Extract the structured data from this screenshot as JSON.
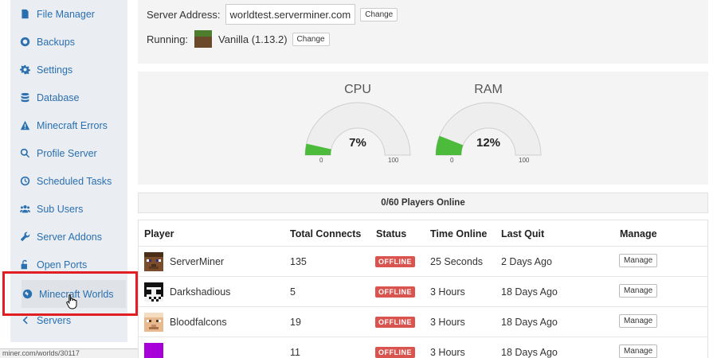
{
  "sidebar": {
    "items": [
      {
        "label": "File Manager",
        "icon": "file-icon"
      },
      {
        "label": "Backups",
        "icon": "lifebuoy-icon"
      },
      {
        "label": "Settings",
        "icon": "gear-icon"
      },
      {
        "label": "Database",
        "icon": "database-icon"
      },
      {
        "label": "Minecraft Errors",
        "icon": "warning-icon"
      },
      {
        "label": "Profile Server",
        "icon": "search-icon"
      },
      {
        "label": "Scheduled Tasks",
        "icon": "clock-icon"
      },
      {
        "label": "Sub Users",
        "icon": "users-icon"
      },
      {
        "label": "Server Addons",
        "icon": "wrench-icon"
      },
      {
        "label": "Open Ports",
        "icon": "unlock-icon"
      },
      {
        "label": "Minecraft Worlds",
        "icon": "globe-icon"
      }
    ],
    "back": {
      "label": "Servers",
      "icon": "chevron-left-icon"
    },
    "link_color": "#2a6fb0"
  },
  "statusbar": {
    "url": "miner.com/worlds/30117"
  },
  "server": {
    "address_label": "Server Address:",
    "address": "worldtest.serverminer.com",
    "change_label": "Change",
    "running_label": "Running:",
    "version": "Vanilla (1.13.2)"
  },
  "gauges": [
    {
      "title": "CPU",
      "value": 7,
      "display": "7%",
      "min_label": "0",
      "max_label": "100"
    },
    {
      "title": "RAM",
      "value": 12,
      "display": "12%",
      "min_label": "0",
      "max_label": "100"
    }
  ],
  "gauge_colors": {
    "fill": "#4cbb3c",
    "track": "#eeeeee"
  },
  "players": {
    "header": "0/60 Players Online",
    "columns": [
      "Player",
      "Total Connects",
      "Status",
      "Time Online",
      "Last Quit",
      "Manage"
    ],
    "rows": [
      {
        "name": "ServerMiner",
        "connects": "135",
        "status": "OFFLINE",
        "time_online": "25 Seconds",
        "last_quit": "2 Days Ago",
        "manage": "Manage"
      },
      {
        "name": "Darkshadious",
        "connects": "5",
        "status": "OFFLINE",
        "time_online": "3 Hours",
        "last_quit": "18 Days Ago",
        "manage": "Manage"
      },
      {
        "name": "Bloodfalcons",
        "connects": "19",
        "status": "OFFLINE",
        "time_online": "3 Hours",
        "last_quit": "18 Days Ago",
        "manage": "Manage"
      },
      {
        "name": "",
        "connects": "11",
        "status": "OFFLINE",
        "time_online": "3 Hours",
        "last_quit": "18 Days Ago",
        "manage": "Manage"
      }
    ],
    "offline_color": "#d9534f"
  }
}
